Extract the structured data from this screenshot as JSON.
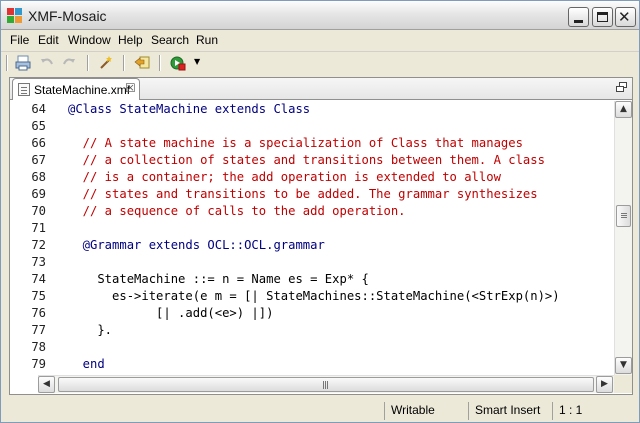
{
  "window": {
    "title": "XMF-Mosaic"
  },
  "menubar": {
    "items": [
      "File",
      "Edit",
      "Window",
      "Help",
      "Search",
      "Run"
    ]
  },
  "toolbar": {
    "icons": [
      "print-icon",
      "undo-icon",
      "redo-icon",
      "wand-icon",
      "back-history-icon",
      "run-icon"
    ]
  },
  "editor": {
    "tab_label": "StateMachine.xmf",
    "lines": [
      {
        "num": "64",
        "text": "@Class StateMachine extends Class",
        "kind": "keyword"
      },
      {
        "num": "65",
        "text": "",
        "kind": "plain"
      },
      {
        "num": "66",
        "text": "  // A state machine is a specialization of Class that manages",
        "kind": "comment"
      },
      {
        "num": "67",
        "text": "  // a collection of states and transitions between them. A class",
        "kind": "comment"
      },
      {
        "num": "68",
        "text": "  // is a container; the add operation is extended to allow",
        "kind": "comment"
      },
      {
        "num": "69",
        "text": "  // states and transitions to be added. The grammar synthesizes",
        "kind": "comment"
      },
      {
        "num": "70",
        "text": "  // a sequence of calls to the add operation.",
        "kind": "comment"
      },
      {
        "num": "71",
        "text": "",
        "kind": "plain"
      },
      {
        "num": "72",
        "text": "  @Grammar extends OCL::OCL.grammar",
        "kind": "keyword"
      },
      {
        "num": "73",
        "text": "",
        "kind": "plain"
      },
      {
        "num": "74",
        "text": "    StateMachine ::= n = Name es = Exp* {",
        "kind": "plain"
      },
      {
        "num": "75",
        "text": "      es->iterate(e m = [| StateMachines::StateMachine(<StrExp(n)>)",
        "kind": "plain"
      },
      {
        "num": "76",
        "text": "            [| .add(<e>) |])",
        "kind": "plain"
      },
      {
        "num": "77",
        "text": "    }.",
        "kind": "plain"
      },
      {
        "num": "78",
        "text": "",
        "kind": "plain"
      },
      {
        "num": "79",
        "text": "  end",
        "kind": "keyword"
      }
    ]
  },
  "statusbar": {
    "mode": "Writable",
    "insert_mode": "Smart Insert",
    "position": "1 : 1"
  },
  "colors": {
    "comment": "#c00000",
    "keyword": "#000080",
    "accent": "#316ac5"
  }
}
